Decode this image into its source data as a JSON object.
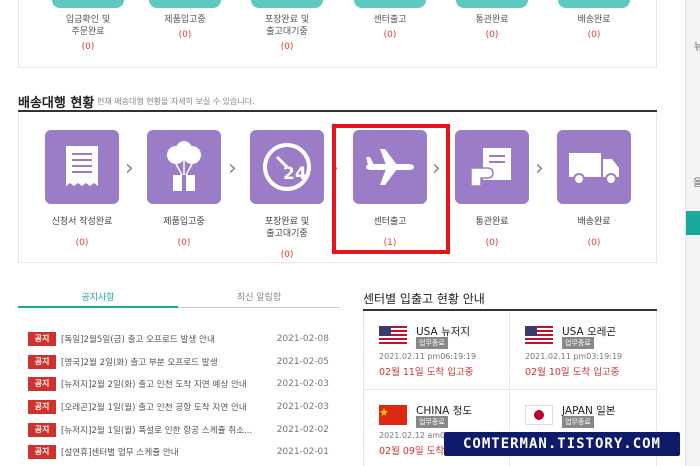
{
  "top_row": {
    "items": [
      {
        "label": "입금확인 및\n주문완료",
        "count": "(0)"
      },
      {
        "label": "제품입고중",
        "count": "(0)"
      },
      {
        "label": "포장완료 및\n출고대기중",
        "count": "(0)"
      },
      {
        "label": "센터출고",
        "count": "(0)"
      },
      {
        "label": "통관완료",
        "count": "(0)"
      },
      {
        "label": "배송완료",
        "count": "(0)"
      }
    ]
  },
  "section": {
    "title": "배송대행 현황",
    "desc": "현재 배송대행 현황을 자세히 보실 수 있습니다.",
    "steps": [
      {
        "label": "신청서 작성완료",
        "count": "(0)",
        "icon": "receipt-icon"
      },
      {
        "label": "제품입고중",
        "count": "(0)",
        "icon": "balloon-gift-icon"
      },
      {
        "label": "포장완료 및\n출고대기중",
        "count": "(0)",
        "icon": "clock-24-icon"
      },
      {
        "label": "센터출고",
        "count": "(1)",
        "icon": "airplane-icon"
      },
      {
        "label": "통관완료",
        "count": "(0)",
        "icon": "document-hand-icon"
      },
      {
        "label": "배송완료",
        "count": "(0)",
        "icon": "delivery-truck-icon"
      }
    ]
  },
  "tabs": {
    "notice": "공지사항",
    "recent": "최신 알림함"
  },
  "notices": [
    {
      "badge": "공지",
      "title": "[독일]2월5일(금) 출고 오프로드 발생 안내",
      "date": "2021-02-08"
    },
    {
      "badge": "공지",
      "title": "[영국]2월 2일(화) 출고 부분 오프로드 발생",
      "date": "2021-02-05"
    },
    {
      "badge": "공지",
      "title": "[뉴저지]2월 2일(화) 출고 인천 도착 지연 예상 안내",
      "date": "2021-02-03"
    },
    {
      "badge": "공지",
      "title": "[오레곤]2월 1일(월) 출고 인천 공항 도착 지연 안내",
      "date": "2021-02-03"
    },
    {
      "badge": "공지",
      "title": "[뉴저지]2월 1일(월) 폭설로 인한 항공 스케쥴 취소...",
      "date": "2021-02-02"
    },
    {
      "badge": "공지",
      "title": "[설연휴]센터별 업무 스케쥴 안내",
      "date": "2021-02-01"
    }
  ],
  "centers": {
    "title": "센터별 입출고 현황 안내",
    "items": [
      {
        "name": "USA 뉴저지",
        "status": "업무종료",
        "time": "2021.02.11 pm06:19:19",
        "arrival": "02월 11일 도착 입고중",
        "flag": "usa-flag-icon"
      },
      {
        "name": "USA 오레곤",
        "status": "업무종료",
        "time": "2021.02.11 pm03:19:19",
        "arrival": "02월 10일 도착 입고중",
        "flag": "usa-flag-icon"
      },
      {
        "name": "CHINA 청도",
        "status": "업무종료",
        "time": "2021.02.12 am07",
        "arrival": "02월 09일 도착 입",
        "flag": "china-flag-icon"
      },
      {
        "name": "JAPAN 일본",
        "status": "업무종료",
        "time": "",
        "arrival": "",
        "flag": "japan-flag-icon"
      }
    ]
  },
  "watermark": "COMTERMAN.TISTORY.COM",
  "sidebar": {
    "frag1": "뉴",
    "frag2": "올"
  },
  "colors": {
    "purple": "#9b7cc7",
    "teal": "#5ec9c0",
    "red": "#d0312d",
    "highlight": "#e3161c"
  }
}
